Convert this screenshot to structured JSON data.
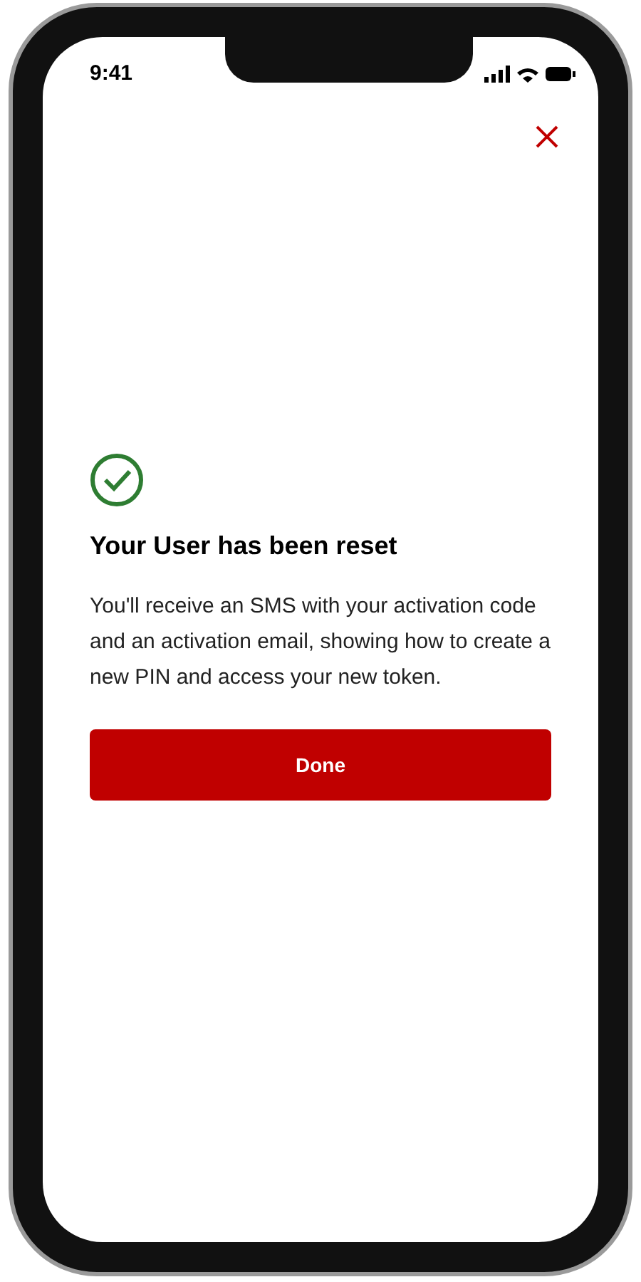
{
  "status_bar": {
    "time": "9:41"
  },
  "dialog": {
    "title": "Your User has been reset",
    "message": "You'll receive an SMS with your activation code and an activation email, showing how to create a new PIN and access your new token.",
    "button": "Done"
  }
}
